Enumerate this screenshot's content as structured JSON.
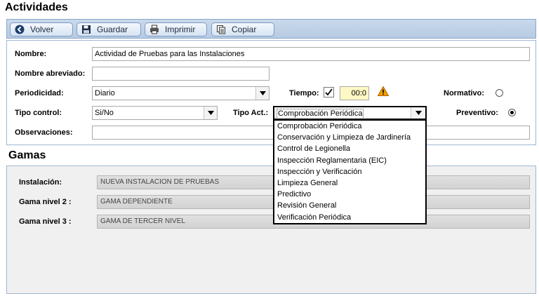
{
  "header": {
    "title": "Actividades"
  },
  "toolbar": {
    "back_label": "Volver",
    "save_label": "Guardar",
    "print_label": "Imprimir",
    "copy_label": "Copiar"
  },
  "form": {
    "nombre_label": "Nombre:",
    "nombre_value": "Actividad de Pruebas para las Instalaciones",
    "nombre_abrev_label": "Nombre abreviado:",
    "nombre_abrev_value": "",
    "periodicidad_label": "Periodicidad:",
    "periodicidad_value": "Diario",
    "tiempo_label": "Tiempo:",
    "tiempo_checked": true,
    "tiempo_value": "00:0",
    "normativo_label": "Normativo:",
    "normativo_selected": false,
    "tipo_control_label": "Tipo control:",
    "tipo_control_value": "Si/No",
    "tipo_act_label": "Tipo Act.:",
    "tipo_act_value": "Comprobación Periódica",
    "preventivo_label": "Preventivo:",
    "preventivo_selected": true,
    "observaciones_label": "Observaciones:",
    "observaciones_value": ""
  },
  "tipo_act_options": [
    "Comprobación Periódica",
    "Conservación y Limpieza de Jardinería",
    "Control de Legionella",
    "Inspección Reglamentaria (EIC)",
    "Inspección y Verificación",
    "Limpieza General",
    "Predictivo",
    "Revisión General",
    "Verificación Periódica"
  ],
  "gamas": {
    "title": "Gamas",
    "instalacion_label": "Instalación:",
    "instalacion_value": "NUEVA INSTALACION DE PRUEBAS",
    "nivel2_label": "Gama nivel 2 :",
    "nivel2_value": "GAMA DEPENDIENTE",
    "nivel3_label": "Gama nivel 3 :",
    "nivel3_value": "GAMA DE TERCER NIVEL"
  },
  "colors": {
    "toolbar_bg": "#c9d9ec",
    "tiempo_bg": "#fff8c4",
    "warning": "#e07b00"
  }
}
